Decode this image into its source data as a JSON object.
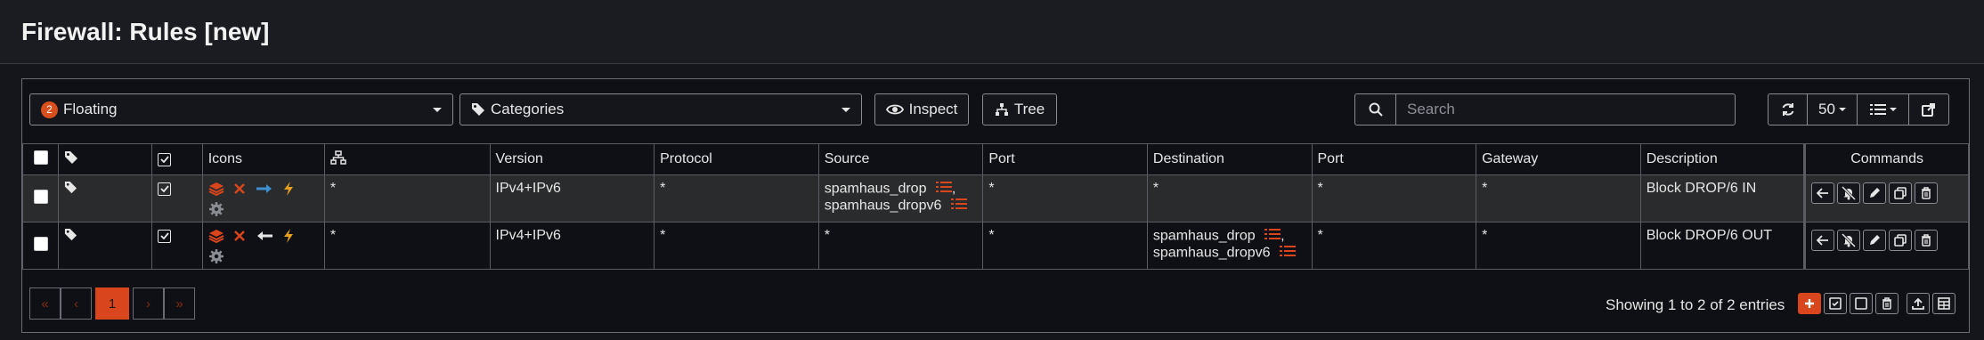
{
  "page": {
    "title": "Firewall: Rules [new]"
  },
  "toolbar": {
    "interface_badge": "2",
    "interface_label": "Floating",
    "categories_label": "Categories",
    "inspect_label": "Inspect",
    "tree_label": "Tree",
    "search_placeholder": "Search",
    "rows_per_page": "50"
  },
  "table": {
    "headers": {
      "icons": "Icons",
      "version": "Version",
      "protocol": "Protocol",
      "source": "Source",
      "source_port": "Port",
      "destination": "Destination",
      "dest_port": "Port",
      "gateway": "Gateway",
      "description": "Description",
      "commands": "Commands"
    },
    "rows": [
      {
        "network": "*",
        "version": "IPv4+IPv6",
        "protocol": "*",
        "source_1": "spamhaus_drop",
        "source_sep": ",",
        "source_2": "spamhaus_dropv6",
        "source_port": "*",
        "destination": "*",
        "dest_port": "*",
        "gateway": "*",
        "description": "Block DROP/6 IN",
        "direction_icon": "arrow-right-icon"
      },
      {
        "network": "*",
        "version": "IPv4+IPv6",
        "protocol": "*",
        "source": "*",
        "source_port": "*",
        "destination_1": "spamhaus_drop",
        "destination_sep": ",",
        "destination_2": "spamhaus_dropv6",
        "dest_port": "*",
        "gateway": "*",
        "description": "Block DROP/6 OUT",
        "direction_icon": "arrow-left-icon"
      }
    ]
  },
  "pagination": {
    "first": "«",
    "prev": "‹",
    "current": "1",
    "next": "›",
    "last": "»",
    "entries_text": "Showing 1 to 2 of 2 entries"
  },
  "colors": {
    "accent": "#d9451c",
    "arrow_in": "#3d8fd1",
    "lightning": "#e8a020"
  }
}
